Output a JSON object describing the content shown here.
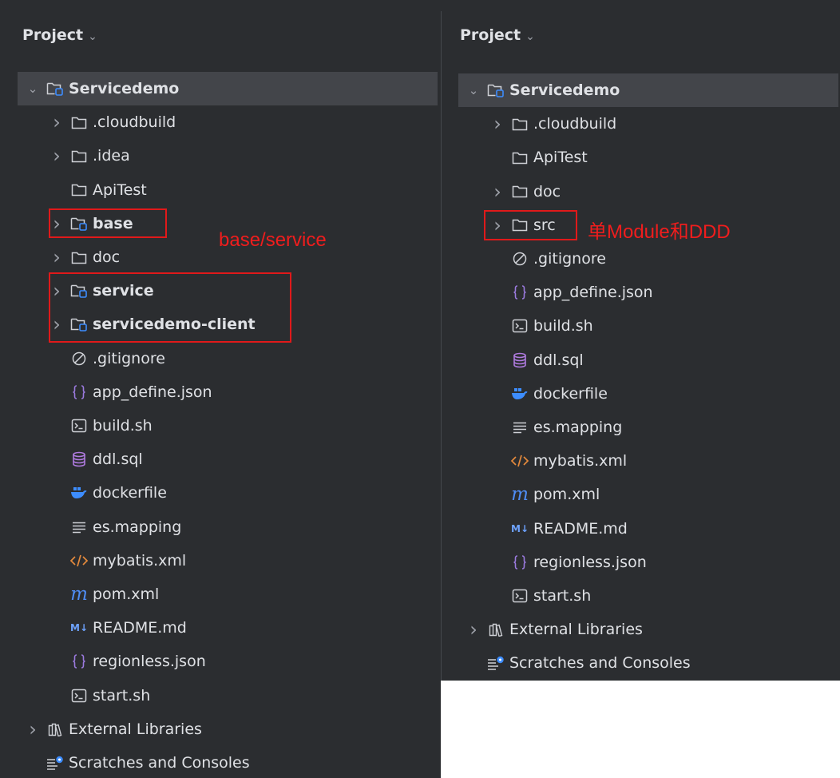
{
  "left": {
    "header": "Project",
    "tree": [
      {
        "label": "Servicedemo",
        "icon": "module-folder-icon",
        "arrow": "down",
        "bold": true,
        "selected": true,
        "indent": 0
      },
      {
        "label": ".cloudbuild",
        "icon": "folder-icon",
        "arrow": "right",
        "indent": 1
      },
      {
        "label": ".idea",
        "icon": "folder-icon",
        "arrow": "right",
        "indent": 1
      },
      {
        "label": "ApiTest",
        "icon": "folder-icon",
        "arrow": "none",
        "indent": 1
      },
      {
        "label": "base",
        "icon": "module-folder-icon",
        "arrow": "right",
        "bold": true,
        "indent": 1
      },
      {
        "label": "doc",
        "icon": "folder-icon",
        "arrow": "right",
        "indent": 1
      },
      {
        "label": "service",
        "icon": "module-folder-icon",
        "arrow": "right",
        "bold": true,
        "indent": 1
      },
      {
        "label": "servicedemo-client",
        "icon": "module-folder-icon",
        "arrow": "right",
        "bold": true,
        "indent": 1
      },
      {
        "label": ".gitignore",
        "icon": "ignore-icon",
        "arrow": "none",
        "indent": 1
      },
      {
        "label": "app_define.json",
        "icon": "json-icon",
        "arrow": "none",
        "indent": 1
      },
      {
        "label": "build.sh",
        "icon": "shell-icon",
        "arrow": "none",
        "indent": 1
      },
      {
        "label": "ddl.sql",
        "icon": "database-icon",
        "arrow": "none",
        "indent": 1
      },
      {
        "label": "dockerfile",
        "icon": "docker-icon",
        "arrow": "none",
        "indent": 1
      },
      {
        "label": "es.mapping",
        "icon": "text-lines-icon",
        "arrow": "none",
        "indent": 1
      },
      {
        "label": "mybatis.xml",
        "icon": "xml-icon",
        "arrow": "none",
        "indent": 1
      },
      {
        "label": "pom.xml",
        "icon": "maven-icon",
        "arrow": "none",
        "indent": 1
      },
      {
        "label": "README.md",
        "icon": "markdown-icon",
        "arrow": "none",
        "indent": 1
      },
      {
        "label": "regionless.json",
        "icon": "json-icon",
        "arrow": "none",
        "indent": 1
      },
      {
        "label": "start.sh",
        "icon": "shell-icon",
        "arrow": "none",
        "indent": 1
      },
      {
        "label": "External Libraries",
        "icon": "library-icon",
        "arrow": "right",
        "indent": 0
      },
      {
        "label": "Scratches and Consoles",
        "icon": "scratches-icon",
        "arrow": "none",
        "indent": 0
      }
    ],
    "annotation": "base/service"
  },
  "right": {
    "header": "Project",
    "tree": [
      {
        "label": "Servicedemo",
        "icon": "module-folder-icon",
        "arrow": "down",
        "bold": true,
        "selected": true,
        "indent": 0
      },
      {
        "label": ".cloudbuild",
        "icon": "folder-icon",
        "arrow": "right",
        "indent": 1
      },
      {
        "label": "ApiTest",
        "icon": "folder-icon",
        "arrow": "none",
        "indent": 1
      },
      {
        "label": "doc",
        "icon": "folder-icon",
        "arrow": "right",
        "indent": 1
      },
      {
        "label": "src",
        "icon": "folder-icon",
        "arrow": "right",
        "indent": 1
      },
      {
        "label": ".gitignore",
        "icon": "ignore-icon",
        "arrow": "none",
        "indent": 1
      },
      {
        "label": "app_define.json",
        "icon": "json-icon",
        "arrow": "none",
        "indent": 1
      },
      {
        "label": "build.sh",
        "icon": "shell-icon",
        "arrow": "none",
        "indent": 1
      },
      {
        "label": "ddl.sql",
        "icon": "database-icon",
        "arrow": "none",
        "indent": 1
      },
      {
        "label": "dockerfile",
        "icon": "docker-icon",
        "arrow": "none",
        "indent": 1
      },
      {
        "label": "es.mapping",
        "icon": "text-lines-icon",
        "arrow": "none",
        "indent": 1
      },
      {
        "label": "mybatis.xml",
        "icon": "xml-icon",
        "arrow": "none",
        "indent": 1
      },
      {
        "label": "pom.xml",
        "icon": "maven-icon",
        "arrow": "none",
        "indent": 1
      },
      {
        "label": "README.md",
        "icon": "markdown-icon",
        "arrow": "none",
        "indent": 1
      },
      {
        "label": "regionless.json",
        "icon": "json-icon",
        "arrow": "none",
        "indent": 1
      },
      {
        "label": "start.sh",
        "icon": "shell-icon",
        "arrow": "none",
        "indent": 1
      },
      {
        "label": "External Libraries",
        "icon": "library-icon",
        "arrow": "right",
        "indent": 0
      },
      {
        "label": "Scratches and Consoles",
        "icon": "scratches-icon",
        "arrow": "none",
        "indent": 0
      }
    ],
    "annotation": "单Module和DDD"
  },
  "colors": {
    "panel_bg": "#2b2d30",
    "selected_row": "#43454a",
    "text": "#dfe1e5",
    "highlight_red": "#e0191a",
    "module_blue": "#3d8dff"
  }
}
